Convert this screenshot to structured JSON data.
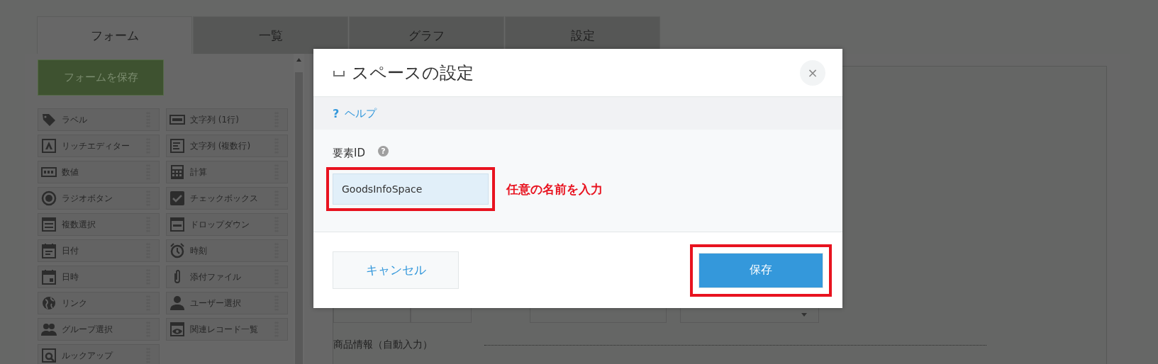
{
  "tabs": [
    {
      "label": "フォーム",
      "selected": true
    },
    {
      "label": "一覧",
      "selected": false
    },
    {
      "label": "グラフ",
      "selected": false
    },
    {
      "label": "設定",
      "selected": false
    }
  ],
  "palette": {
    "save_button": "フォームを保存",
    "items": [
      {
        "label": "ラベル"
      },
      {
        "label": "文字列 (1行)"
      },
      {
        "label": "リッチエディター"
      },
      {
        "label": "文字列 (複数行)"
      },
      {
        "label": "数値"
      },
      {
        "label": "計算"
      },
      {
        "label": "ラジオボタン"
      },
      {
        "label": "チェックボックス"
      },
      {
        "label": "複数選択"
      },
      {
        "label": "ドロップダウン"
      },
      {
        "label": "日付"
      },
      {
        "label": "時刻"
      },
      {
        "label": "日時"
      },
      {
        "label": "添付ファイル"
      },
      {
        "label": "リンク"
      },
      {
        "label": "ユーザー選択"
      },
      {
        "label": "グループ選択"
      },
      {
        "label": "関連レコード一覧"
      },
      {
        "label": "ルックアップ"
      }
    ]
  },
  "canvas": {
    "section_label": "商品情報（自動入力）"
  },
  "dialog": {
    "title": "スペースの設定",
    "close_button": "×",
    "help_icon": "?",
    "help_link": "ヘルプ",
    "field_label": "要素ID",
    "hint_icon": "?",
    "field_value": "GoodsInfoSpace",
    "annotation": "任意の名前を入力",
    "cancel_button": "キャンセル",
    "save_button": "保存"
  }
}
